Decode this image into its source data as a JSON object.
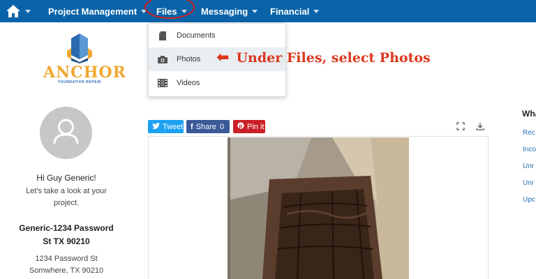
{
  "nav": {
    "items": [
      {
        "label": "Project Management"
      },
      {
        "label": "Files"
      },
      {
        "label": "Messaging"
      },
      {
        "label": "Financial"
      }
    ]
  },
  "files_menu": {
    "items": [
      {
        "label": "Documents",
        "icon": "document-icon"
      },
      {
        "label": "Photos",
        "icon": "camera-icon"
      },
      {
        "label": "Videos",
        "icon": "film-icon"
      }
    ],
    "highlighted": "Photos"
  },
  "annotation": {
    "text": "Under Files, select Photos"
  },
  "brand": {
    "name": "ANCHOR",
    "tagline": "FOUNDATION REPAIR"
  },
  "profile": {
    "greeting": "Hi Guy Generic!",
    "subtitle_line1": "Let's take a look at your",
    "subtitle_line2": "project.",
    "project_line1": "Generic-1234 Password",
    "project_line2": "St TX 90210",
    "address_line1": "1234 Password St",
    "address_line2": "Somwhere, TX 90210"
  },
  "share": {
    "tweet_label": "Tweet",
    "facebook_label": "Share",
    "facebook_count": "0",
    "pin_label": "Pin it"
  },
  "right_panel": {
    "title": "Wha",
    "links": [
      "Rec",
      "Inco",
      "Unr",
      "Unr",
      "Upc"
    ]
  },
  "colors": {
    "nav_bg": "#0a63a8",
    "accent_red": "#d21f1f",
    "annotation": "#d9381e",
    "link": "#2a6fb3",
    "brand_gold": "#efa832",
    "brand_blue": "#2a6bb0"
  }
}
